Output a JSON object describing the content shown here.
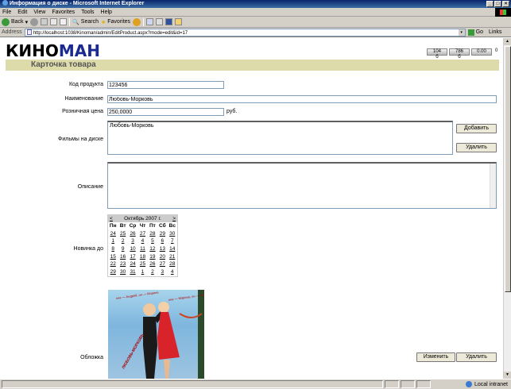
{
  "window": {
    "title": "Информация о диске - Microsoft Internet Explorer"
  },
  "menu": [
    "File",
    "Edit",
    "View",
    "Favorites",
    "Tools",
    "Help"
  ],
  "toolbar": {
    "back": "Back",
    "search": "Search",
    "favorites": "Favorites"
  },
  "address": {
    "label": "Address",
    "url": "http://localhost:1038/Kinoman/admin/EditProduct.aspx?mode=edit&id=17",
    "go": "Go",
    "links": "Links"
  },
  "logo": {
    "part1": "КИНО",
    "part2": "МАН"
  },
  "stats": [
    "104 б",
    "786 б",
    "0.00",
    "0"
  ],
  "page": {
    "title": "Карточка товара"
  },
  "form": {
    "code_label": "Код продукта",
    "code_value": "123456",
    "name_label": "Наименование",
    "name_value": "Любовь-Морковь",
    "price_label": "Розничная цена",
    "price_value": "250,0000",
    "price_unit": "руб.",
    "films_label": "Фильмы на диске",
    "films_list": [
      "Любовь-Морковь"
    ],
    "add_button": "Добавить",
    "delete_button": "Удалить",
    "description_label": "Описание",
    "description_value": "",
    "new_until_label": "Новинка до",
    "cover_label": "Обложка",
    "change_button": "Изменить",
    "cover_delete_button": "Удалить"
  },
  "calendar": {
    "prev": "<",
    "next": ">",
    "month": "Октябрь 2007 г.",
    "dows": [
      "Пн",
      "Вт",
      "Ср",
      "Чт",
      "Пт",
      "Сб",
      "Вс"
    ],
    "days": [
      "24",
      "25",
      "26",
      "27",
      "28",
      "29",
      "30",
      "1",
      "2",
      "3",
      "4",
      "5",
      "6",
      "7",
      "8",
      "9",
      "10",
      "11",
      "12",
      "13",
      "14",
      "15",
      "16",
      "17",
      "18",
      "19",
      "20",
      "21",
      "22",
      "23",
      "24",
      "25",
      "26",
      "27",
      "28",
      "29",
      "30",
      "31",
      "1",
      "2",
      "3",
      "4"
    ]
  },
  "cover_art": {
    "caption_left": "она — Андрей, он — Марина",
    "caption_right": "она — Марина, он — Андрей",
    "caption_bottom": "ЛЮБОВЬ-МОРКОВЬ"
  },
  "status": {
    "zone": "Local intranet"
  }
}
